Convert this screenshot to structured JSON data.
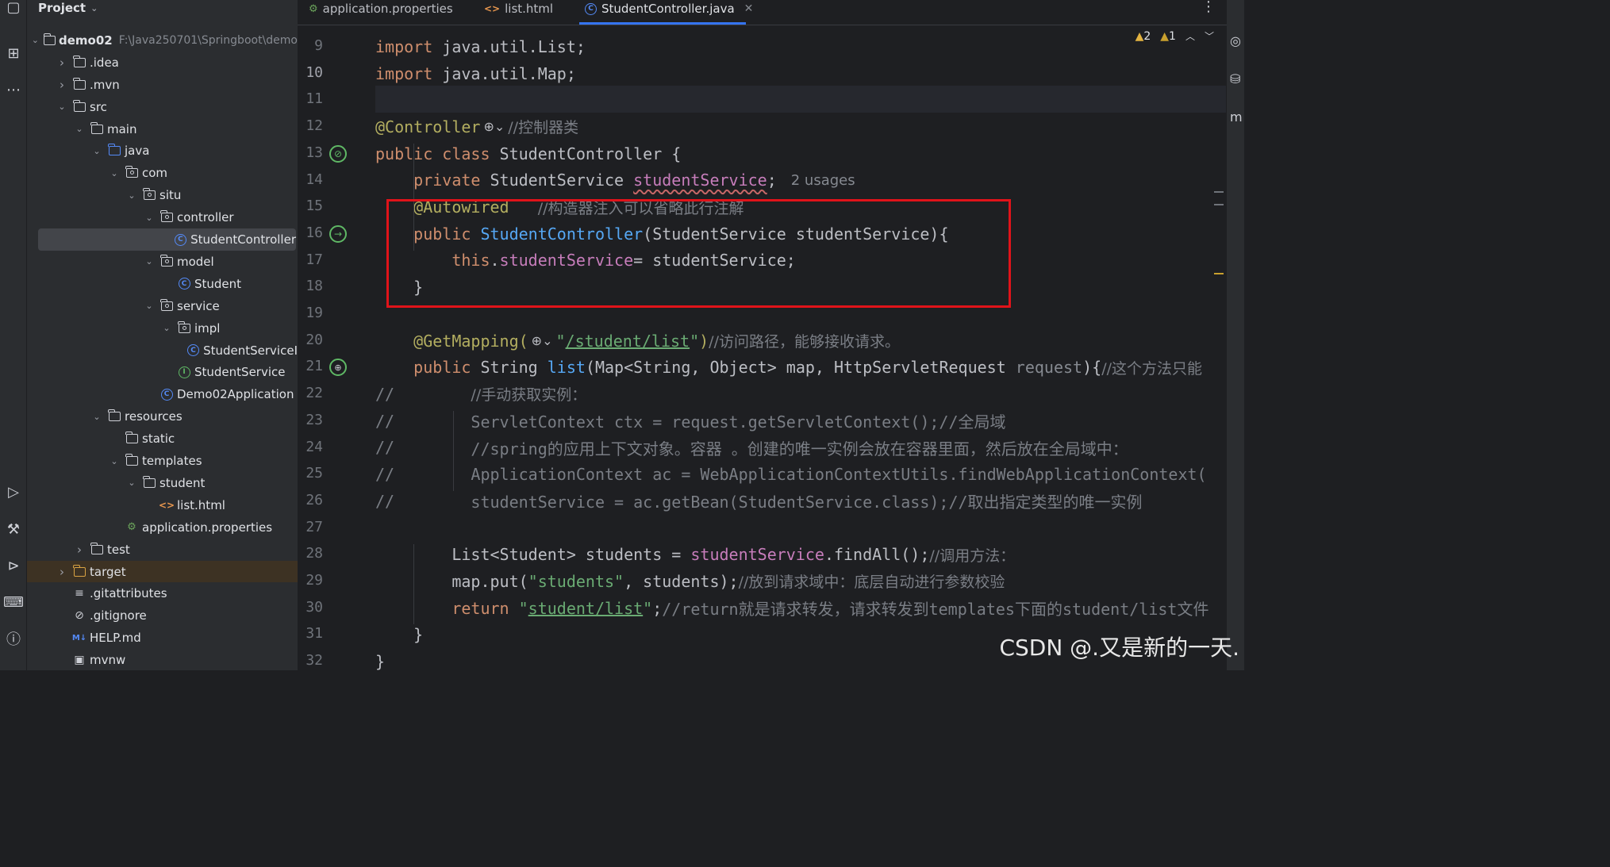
{
  "project_panel": {
    "title": "Project",
    "tree": [
      {
        "label": "demo02",
        "hint": "F:\\Java250701\\Springboot\\demo",
        "depth": 0,
        "icon": "module-folder",
        "expanded": true,
        "bold": true
      },
      {
        "label": ".idea",
        "depth": 1,
        "icon": "folder",
        "expanded": false
      },
      {
        "label": ".mvn",
        "depth": 1,
        "icon": "folder",
        "expanded": false
      },
      {
        "label": "src",
        "depth": 1,
        "icon": "folder",
        "expanded": true
      },
      {
        "label": "main",
        "depth": 2,
        "icon": "folder",
        "expanded": true
      },
      {
        "label": "java",
        "depth": 3,
        "icon": "source-folder",
        "expanded": true
      },
      {
        "label": "com",
        "depth": 4,
        "icon": "package",
        "expanded": true
      },
      {
        "label": "situ",
        "depth": 5,
        "icon": "package",
        "expanded": true
      },
      {
        "label": "controller",
        "depth": 6,
        "icon": "package",
        "expanded": true
      },
      {
        "label": "StudentController",
        "depth": 7,
        "icon": "class",
        "selected": true
      },
      {
        "label": "model",
        "depth": 6,
        "icon": "package",
        "expanded": true
      },
      {
        "label": "Student",
        "depth": 7,
        "icon": "class"
      },
      {
        "label": "service",
        "depth": 6,
        "icon": "package",
        "expanded": true
      },
      {
        "label": "impl",
        "depth": 7,
        "icon": "package",
        "expanded": true
      },
      {
        "label": "StudentServiceI",
        "depth": 8,
        "icon": "class"
      },
      {
        "label": "StudentService",
        "depth": 7,
        "icon": "interface"
      },
      {
        "label": "Demo02Application",
        "depth": 6,
        "icon": "spring-class"
      },
      {
        "label": "resources",
        "depth": 3,
        "icon": "resources-folder",
        "expanded": true
      },
      {
        "label": "static",
        "depth": 4,
        "icon": "folder"
      },
      {
        "label": "templates",
        "depth": 4,
        "icon": "folder",
        "expanded": true
      },
      {
        "label": "student",
        "depth": 5,
        "icon": "folder",
        "expanded": true
      },
      {
        "label": "list.html",
        "depth": 6,
        "icon": "html"
      },
      {
        "label": "application.properties",
        "depth": 4,
        "icon": "properties"
      },
      {
        "label": "test",
        "depth": 2,
        "icon": "folder",
        "expanded": false
      },
      {
        "label": "target",
        "depth": 1,
        "icon": "excluded-folder",
        "expanded": false
      },
      {
        "label": ".gitattributes",
        "depth": 1,
        "icon": "text-file"
      },
      {
        "label": ".gitignore",
        "depth": 1,
        "icon": "ignore-file"
      },
      {
        "label": "HELP.md",
        "depth": 1,
        "icon": "markdown"
      },
      {
        "label": "mvnw",
        "depth": 1,
        "icon": "script-file"
      }
    ]
  },
  "tabs": [
    {
      "label": "application.properties",
      "icon": "properties-icon",
      "active": false
    },
    {
      "label": "list.html",
      "icon": "html-icon",
      "active": false
    },
    {
      "label": "StudentController.java",
      "icon": "class-icon",
      "active": true
    }
  ],
  "inspections": {
    "errors_label": "2",
    "warnings_label": "1"
  },
  "editor": {
    "current_line": "10",
    "lines": [
      {
        "n": "9",
        "tokens": [
          [
            "kw",
            "import "
          ],
          [
            "",
            "java.util.List;"
          ]
        ]
      },
      {
        "n": "10",
        "tokens": [
          [
            "kw",
            "import "
          ],
          [
            "",
            "java.util.Map;"
          ]
        ]
      },
      {
        "n": "11",
        "tokens": []
      },
      {
        "n": "12",
        "tokens": [
          [
            "ann",
            "@Controller"
          ],
          [
            "globe",
            "⊕⌄"
          ],
          [
            "cmt",
            "//控制器类"
          ]
        ]
      },
      {
        "n": "13",
        "tokens": [
          [
            "kw",
            "public class "
          ],
          [
            "",
            "StudentController {"
          ]
        ],
        "gutter": "bean"
      },
      {
        "n": "14",
        "tokens": [
          [
            "",
            "    "
          ],
          [
            "kw",
            "private "
          ],
          [
            "",
            "StudentService "
          ],
          [
            "fld wavy",
            "studentService"
          ],
          [
            "",
            ";"
          ],
          [
            "hint",
            "2 usages"
          ]
        ]
      },
      {
        "n": "15",
        "tokens": [
          [
            "",
            "    "
          ],
          [
            "ann",
            "@Autowired"
          ],
          [
            "",
            "   "
          ],
          [
            "cmt",
            "//构造器注入可以省略此行注解"
          ]
        ]
      },
      {
        "n": "16",
        "tokens": [
          [
            "",
            "    "
          ],
          [
            "kw",
            "public "
          ],
          [
            "fn",
            "StudentController"
          ],
          [
            "",
            "(StudentService studentService){"
          ]
        ],
        "gutter": "bean-arrow"
      },
      {
        "n": "17",
        "tokens": [
          [
            "",
            "        "
          ],
          [
            "kw",
            "this"
          ],
          [
            "",
            "."
          ],
          [
            "fld",
            "studentService"
          ],
          [
            "",
            "= studentService;"
          ]
        ]
      },
      {
        "n": "18",
        "tokens": [
          [
            "",
            "    }"
          ]
        ]
      },
      {
        "n": "19",
        "tokens": []
      },
      {
        "n": "20",
        "tokens": [
          [
            "",
            "    "
          ],
          [
            "ann",
            "@GetMapping("
          ],
          [
            "globe",
            "⊕⌄"
          ],
          [
            "str",
            "\""
          ],
          [
            "str under",
            "/student/list"
          ],
          [
            "str",
            "\""
          ],
          [
            "ann",
            ")"
          ],
          [
            "cmt",
            "//访问路径，能够接收请求。"
          ]
        ]
      },
      {
        "n": "21",
        "tokens": [
          [
            "",
            "    "
          ],
          [
            "kw",
            "public "
          ],
          [
            "",
            "String "
          ],
          [
            "fn",
            "list"
          ],
          [
            "",
            "(Map<String, Object> map, HttpServletRequest "
          ],
          [
            "param-gray",
            "request"
          ],
          [
            "",
            "){"
          ],
          [
            "cmt",
            "//这个方法只能"
          ]
        ],
        "gutter": "web"
      },
      {
        "n": "22",
        "tokens": [
          [
            "cmt",
            "//"
          ],
          [
            "",
            "        "
          ],
          [
            "cmt",
            "//手动获取实例："
          ]
        ]
      },
      {
        "n": "23",
        "tokens": [
          [
            "cmt",
            "//"
          ],
          [
            "",
            "        "
          ],
          [
            "cmt",
            "ServletContext ctx = request.getServletContext();//全局域"
          ]
        ]
      },
      {
        "n": "24",
        "tokens": [
          [
            "cmt",
            "//"
          ],
          [
            "",
            "        "
          ],
          [
            "cmt",
            "//spring的应用上下文对象。容器 。创建的唯一实例会放在容器里面，然后放在全局域中："
          ]
        ]
      },
      {
        "n": "25",
        "tokens": [
          [
            "cmt",
            "//"
          ],
          [
            "",
            "        "
          ],
          [
            "cmt",
            "ApplicationContext ac = WebApplicationContextUtils.findWebApplicationContext("
          ]
        ]
      },
      {
        "n": "26",
        "tokens": [
          [
            "cmt",
            "//"
          ],
          [
            "",
            "        "
          ],
          [
            "cmt",
            "studentService = ac.getBean(StudentService.class);//取出指定类型的唯一实例"
          ]
        ]
      },
      {
        "n": "27",
        "tokens": []
      },
      {
        "n": "28",
        "tokens": [
          [
            "",
            "        List<Student> students = "
          ],
          [
            "fld",
            "studentService"
          ],
          [
            "",
            ".findAll();"
          ],
          [
            "cmt",
            "//调用方法："
          ]
        ]
      },
      {
        "n": "29",
        "tokens": [
          [
            "",
            "        map.put("
          ],
          [
            "str",
            "\"students\""
          ],
          [
            "",
            ", students);"
          ],
          [
            "cmt",
            "//放到请求域中：底层自动进行参数校验"
          ]
        ]
      },
      {
        "n": "30",
        "tokens": [
          [
            "",
            "        "
          ],
          [
            "kw",
            "return "
          ],
          [
            "str",
            "\""
          ],
          [
            "str under",
            "student/list"
          ],
          [
            "str",
            "\""
          ],
          [
            "",
            ";"
          ],
          [
            "cmt",
            "//return就是请求转发，请求转发到templates下面的student/list文件"
          ]
        ]
      },
      {
        "n": "31",
        "tokens": [
          [
            "",
            "    }"
          ]
        ]
      },
      {
        "n": "32",
        "tokens": [
          [
            "",
            "}"
          ]
        ]
      }
    ]
  },
  "watermark": "CSDN @.又是新的一天.",
  "colors": {
    "highlight_box": "#e0131a",
    "keyword": "#cf8e6d",
    "annotation": "#b3ae60",
    "string": "#6aab73",
    "comment": "#7a7e85",
    "field": "#c77dbb",
    "method": "#56a8f5"
  }
}
